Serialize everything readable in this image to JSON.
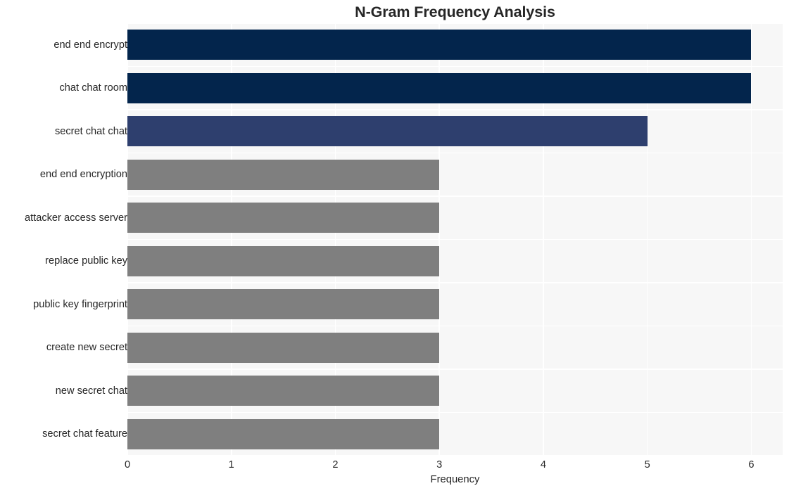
{
  "chart_data": {
    "type": "bar",
    "orientation": "horizontal",
    "title": "N-Gram Frequency Analysis",
    "xlabel": "Frequency",
    "ylabel": "",
    "categories": [
      "end end encrypt",
      "chat chat room",
      "secret chat chat",
      "end end encryption",
      "attacker access server",
      "replace public key",
      "public key fingerprint",
      "create new secret",
      "new secret chat",
      "secret chat feature"
    ],
    "values": [
      6,
      6,
      5,
      3,
      3,
      3,
      3,
      3,
      3,
      3
    ],
    "bar_colors": [
      "#03254c",
      "#03254c",
      "#2e3f6e",
      "#7f7f7f",
      "#7f7f7f",
      "#7f7f7f",
      "#7f7f7f",
      "#7f7f7f",
      "#7f7f7f",
      "#7f7f7f"
    ],
    "xticks": [
      0,
      1,
      2,
      3,
      4,
      5,
      6
    ],
    "xtick_labels": [
      "0",
      "1",
      "2",
      "3",
      "4",
      "5",
      "6"
    ],
    "xlim": [
      0,
      6.302
    ],
    "grid": true,
    "grid_color": "#ffffff",
    "legend": null,
    "plot_background": "#f7f7f7",
    "figure_background": "#ffffff",
    "text_color": "#262626"
  }
}
